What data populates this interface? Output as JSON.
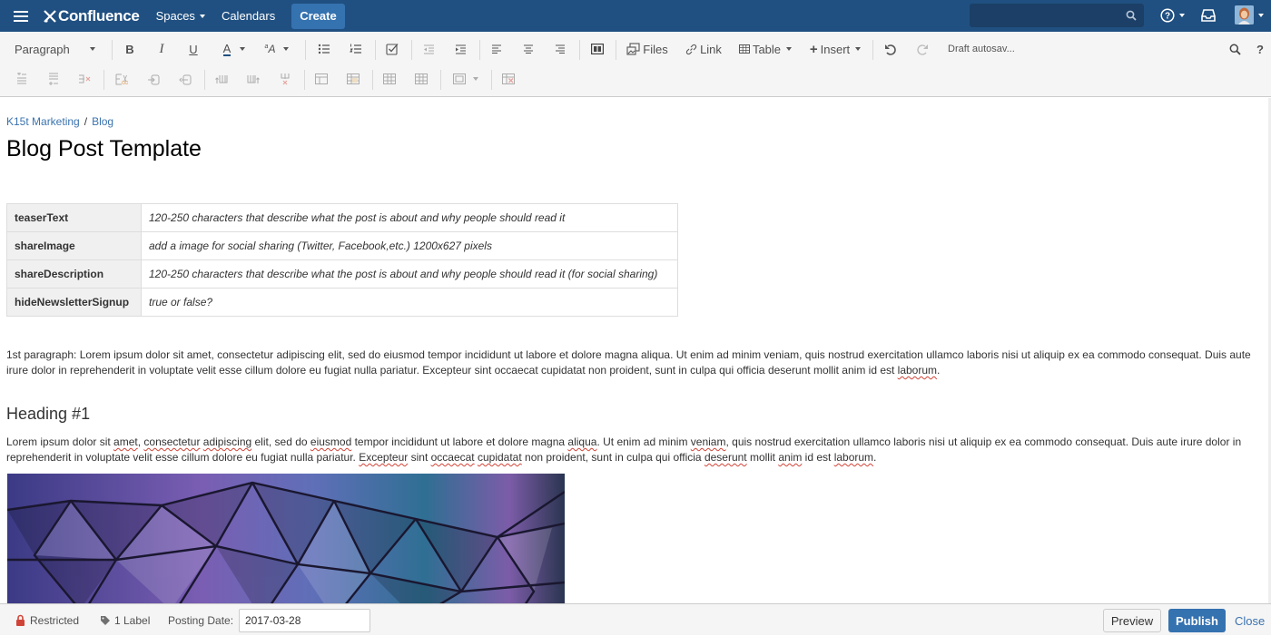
{
  "nav": {
    "logo_text": "Confluence",
    "spaces_label": "Spaces",
    "calendars_label": "Calendars",
    "create_label": "Create",
    "search_placeholder": "",
    "brand_color": "#205081",
    "button_color": "#3572b0"
  },
  "toolbar": {
    "paragraph_label": "Paragraph",
    "files_label": "Files",
    "link_label": "Link",
    "table_label": "Table",
    "insert_label": "Insert",
    "draft_status": "Draft autosav..."
  },
  "page": {
    "breadcrumb": [
      "K15t Marketing",
      "Blog"
    ],
    "breadcrumb_separator": "/",
    "title": "Blog Post Template",
    "properties": [
      {
        "key": "teaserText",
        "value": "120-250 characters that describe what the post is about and why people should read it"
      },
      {
        "key": "shareImage",
        "value": "add a image for social sharing (Twitter, Facebook,etc.) 1200x627 pixels"
      },
      {
        "key": "shareDescription",
        "value": "120-250 characters that describe what the post is about and why people should read it (for social sharing)"
      },
      {
        "key": "hideNewsletterSignup",
        "value": "true or false?"
      }
    ],
    "paragraph1": {
      "a": "1st paragraph: Lorem ipsum dolor sit amet, consectetur adipiscing elit, sed do eiusmod tempor incididunt ut labore et dolore magna aliqua. Ut enim ad minim veniam, quis nostrud exercitation ullamco laboris nisi ut aliquip ex ea commodo consequat. Duis aute irure dolor in reprehenderit in voluptate velit esse cillum dolore eu fugiat nulla pariatur. Excepteur sint occaecat cupidatat non proident, sunt in culpa qui officia deserunt mollit anim id est ",
      "misspelled": "laborum",
      "end": "."
    },
    "heading1": "Heading #1",
    "paragraph2": {
      "s1": "Lorem ipsum dolor sit ",
      "w1": "amet",
      "s2": ", ",
      "w2": "consectetur",
      "s3": " ",
      "w3": "adipiscing",
      "s4": " elit, sed do ",
      "w4": "eiusmod",
      "s5": " tempor incididunt ut labore et dolore magna ",
      "w5": "aliqua",
      "s6": ". Ut enim ad minim ",
      "w6": "veniam",
      "s7": ", quis nostrud exercitation ullamco laboris nisi ut aliquip ex ea commodo consequat. Duis aute irure dolor in reprehenderit in voluptate velit esse cillum dolore eu fugiat nulla pariatur. ",
      "w7": "Excepteur",
      "s8": " sint ",
      "w8": "occaecat",
      "s9": " ",
      "w9": "cupidatat",
      "s10": " non proident, sunt in culpa qui officia ",
      "w10": "deserunt",
      "s11": " mollit ",
      "w11": "anim",
      "s12": " id est ",
      "w12": "laborum",
      "s13": "."
    },
    "hero_image": "abstract-geometric-triangles-purple-blue"
  },
  "footer": {
    "restricted_label": "Restricted",
    "labels_label": "1 Label",
    "posting_date_label": "Posting Date:",
    "posting_date_value": "2017-03-28",
    "preview_label": "Preview",
    "publish_label": "Publish",
    "close_label": "Close",
    "restricted_color": "#d04437"
  }
}
